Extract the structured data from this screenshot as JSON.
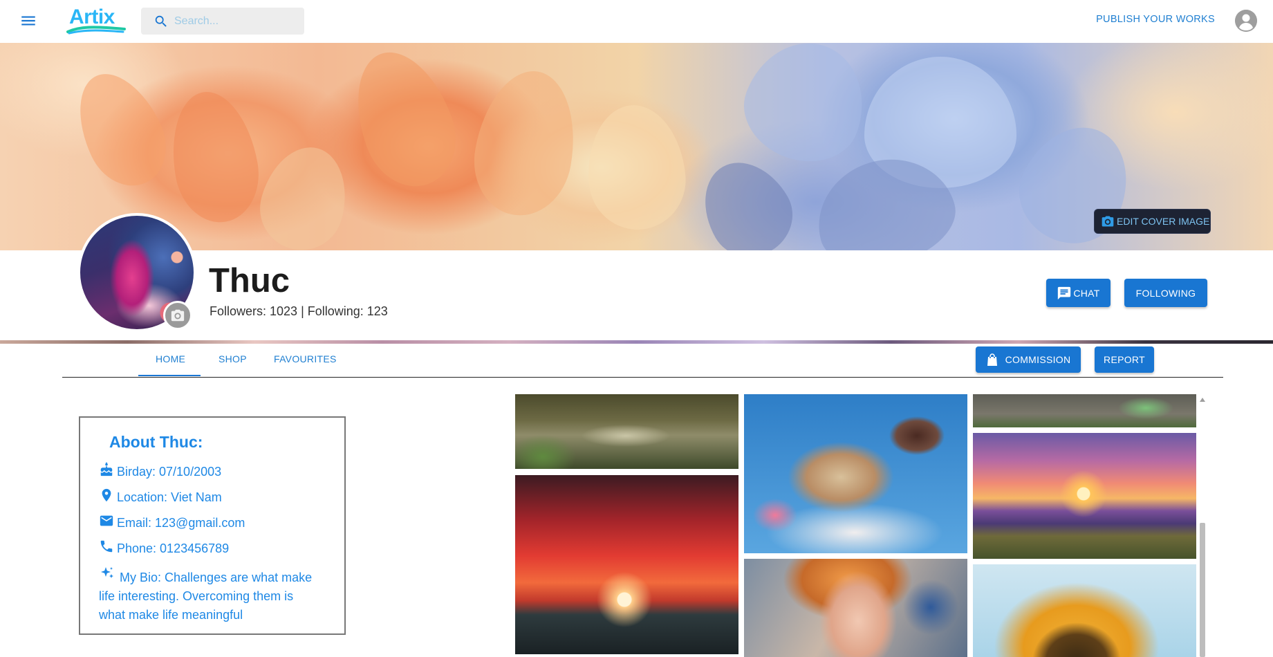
{
  "app": {
    "logo_text": "Artix",
    "search_placeholder": "Search...",
    "publish_label": "PUBLISH YOUR WORKS"
  },
  "cover": {
    "edit_label": "EDIT COVER IMAGE"
  },
  "profile": {
    "name": "Thuc",
    "stats": "Followers: 1023 | Following: 123",
    "chat_label": "CHAT",
    "following_label": "FOLLOWING"
  },
  "tabs": [
    {
      "label": "HOME",
      "active": true
    },
    {
      "label": "SHOP",
      "active": false
    },
    {
      "label": "FAVOURITES",
      "active": false
    }
  ],
  "actions": {
    "commission_label": "COMMISSION",
    "report_label": "REPORT"
  },
  "about": {
    "title": "About Thuc:",
    "birthday": "Birday: 07/10/2003",
    "location": "Location: Viet Nam",
    "email": "Email: 123@gmail.com",
    "phone": "Phone: 0123456789",
    "bio": "My Bio: Challenges are what make life interesting. Overcoming them is what make life meaningful"
  },
  "gallery": {
    "items": [
      {
        "name": "swamp-artwork"
      },
      {
        "name": "red-sunset-artwork"
      },
      {
        "name": "food-diorama-artwork"
      },
      {
        "name": "girl-portrait-artwork"
      },
      {
        "name": "garden-wall-artwork"
      },
      {
        "name": "mountain-lake-sunset-artwork"
      },
      {
        "name": "sunflower-artwork"
      }
    ]
  },
  "colors": {
    "accent": "#1976d2",
    "link": "#1f7fd1",
    "about_text": "#1e88e5"
  },
  "icons": [
    "menu-icon",
    "search-icon",
    "account-circle-icon",
    "camera-icon",
    "chat-icon",
    "shopping-bag-icon",
    "cake-icon",
    "location-pin-icon",
    "email-icon",
    "phone-icon",
    "sparkles-icon",
    "scroll-up-arrow-icon"
  ]
}
